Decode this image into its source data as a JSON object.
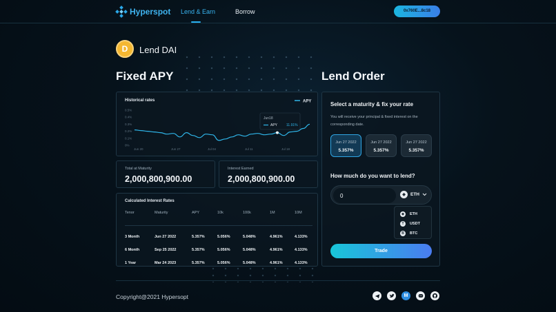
{
  "header": {
    "brand": "Hyperspot",
    "nav": {
      "lend": "Lend & Earn",
      "borrow": "Borrow"
    },
    "wallet": "0x760E...8c18"
  },
  "token": {
    "name": "Lend DAI"
  },
  "fixed_apy": {
    "title": "Fixed APY",
    "chart_title": "Historical rates",
    "legend": "APY",
    "tooltip": {
      "date": "Jun18",
      "label": "APY",
      "value": "11.91%"
    }
  },
  "chart_data": {
    "type": "line",
    "title": "Historical rates",
    "y_ticks": [
      "0.5%",
      "0.4%",
      "0.3%",
      "0.2%",
      "0.1%",
      "0%"
    ],
    "x_ticks": [
      "Jun 20",
      "Jun 27",
      "Jul 04",
      "Jul 11",
      "Jul 18"
    ],
    "ylim": [
      0,
      0.5
    ],
    "series": [
      {
        "name": "APY",
        "values": [
          0.22,
          0.21,
          0.2,
          0.19,
          0.18,
          0.16,
          0.17,
          0.12,
          0.18,
          0.14,
          0.11,
          0.16,
          0.15,
          0.07,
          0.09,
          0.12,
          0.15,
          0.13,
          0.16,
          0.17,
          0.15,
          0.16,
          0.18,
          0.14,
          0.19,
          0.2,
          0.24,
          0.3
        ],
        "color": "#2fb6ea"
      }
    ]
  },
  "totals": {
    "maturity_label": "Total at Maturity",
    "maturity_value": "2,000,800,900.00",
    "interest_label": "Interest Earned",
    "interest_value": "2,000,800,900.00"
  },
  "rates": {
    "title": "Calculated Interest Rates",
    "headers": [
      "Tenor",
      "Maturity",
      "APY",
      "10k",
      "100k",
      "1M",
      "10M"
    ],
    "rows": [
      [
        "3 Month",
        "Jun 27 2022",
        "5.357%",
        "5.056%",
        "5.048%",
        "4.961%",
        "4.133%"
      ],
      [
        "6 Month",
        "Sep 25 2022",
        "5.357%",
        "5.056%",
        "5.048%",
        "4.961%",
        "4.133%"
      ],
      [
        "1 Year",
        "Mar 24 2023",
        "5.357%",
        "5.056%",
        "5.048%",
        "4.961%",
        "4.133%"
      ]
    ]
  },
  "lend_order": {
    "title": "Lend Order",
    "heading": "Select a maturity & fix your rate",
    "description": "You will receive your principal & fixed interest on the corresponding date.",
    "maturities": [
      {
        "date": "Jun 27 2022",
        "rate": "5.357%"
      },
      {
        "date": "Jun 27 2022",
        "rate": "5.357%"
      },
      {
        "date": "Jun 27 2022",
        "rate": "5.357%"
      }
    ],
    "question": "How much do you want to lend?",
    "amount_value": "0",
    "selected_coin": "ETH",
    "coins": [
      "ETH",
      "USDT",
      "BTC"
    ],
    "trade_label": "Trade"
  },
  "footer": {
    "copyright": "Copyright@2021 Hypersopt",
    "socials": [
      "telegram-icon",
      "twitter-icon",
      "medium-icon",
      "discord-icon",
      "github-icon"
    ]
  }
}
